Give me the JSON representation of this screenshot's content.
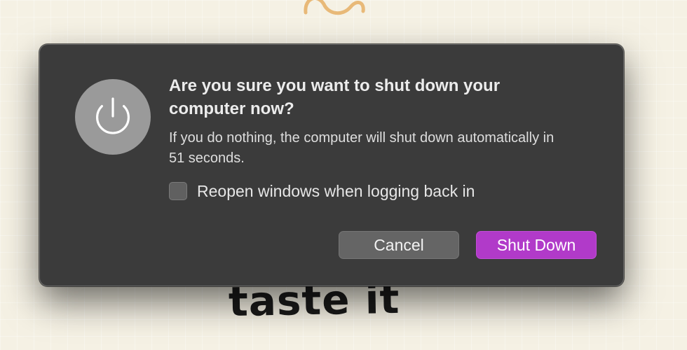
{
  "wallpaper": {
    "handwritten_text": "taste it"
  },
  "dialog": {
    "icon": "power-icon",
    "title": "Are you sure you want to shut down your computer now?",
    "message": "If you do nothing, the computer will shut down automatically in 51 seconds.",
    "countdown_seconds": 51,
    "reopen_checkbox": {
      "label": "Reopen windows when logging back in",
      "checked": false
    },
    "buttons": {
      "cancel_label": "Cancel",
      "primary_label": "Shut Down"
    }
  },
  "colors": {
    "accent": "#b13ac9",
    "dialog_background": "#3b3b3b",
    "wallpaper_background": "#f5f1e4"
  }
}
